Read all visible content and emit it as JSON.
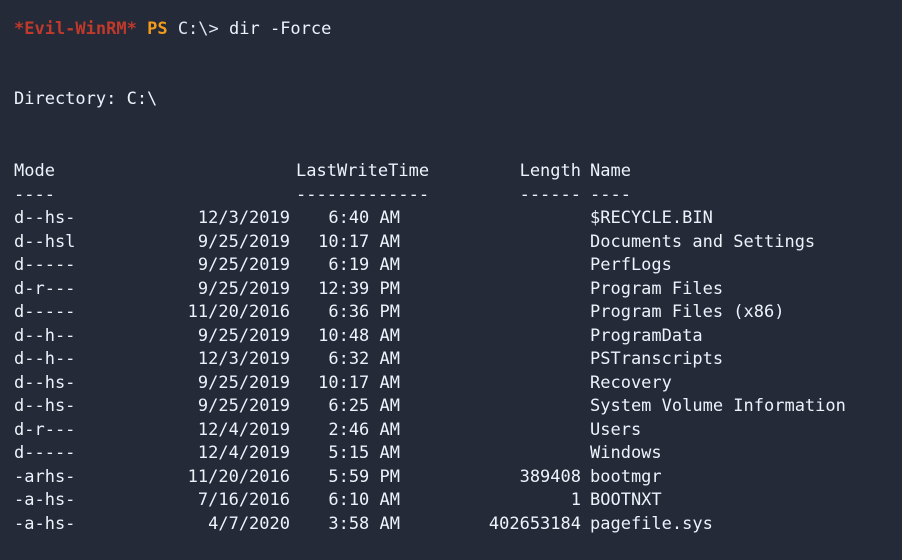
{
  "terminal": {
    "background": "#242a38",
    "foreground": "#eef2fb",
    "prompt": {
      "shell_marker": "*Evil-WinRM*",
      "shell_marker_color": "#c0392b",
      "ps_label": "PS",
      "ps_color": "#f29b1d",
      "path": "C:\\>",
      "command": "dir -Force"
    },
    "directory_header": "Directory: C:\\",
    "columns": {
      "mode": "Mode",
      "lastwritetime": "LastWriteTime",
      "length": "Length",
      "name": "Name"
    },
    "column_rules": {
      "mode": "----",
      "lastwritetime": "-------------",
      "length": "------",
      "name": "----"
    },
    "entries": [
      {
        "mode": "d--hs-",
        "date": "12/3/2019",
        "time": "6:40 AM",
        "length": "",
        "name": "$RECYCLE.BIN"
      },
      {
        "mode": "d--hsl",
        "date": "9/25/2019",
        "time": "10:17 AM",
        "length": "",
        "name": "Documents and Settings"
      },
      {
        "mode": "d-----",
        "date": "9/25/2019",
        "time": "6:19 AM",
        "length": "",
        "name": "PerfLogs"
      },
      {
        "mode": "d-r---",
        "date": "9/25/2019",
        "time": "12:39 PM",
        "length": "",
        "name": "Program Files"
      },
      {
        "mode": "d-----",
        "date": "11/20/2016",
        "time": "6:36 PM",
        "length": "",
        "name": "Program Files (x86)"
      },
      {
        "mode": "d--h--",
        "date": "9/25/2019",
        "time": "10:48 AM",
        "length": "",
        "name": "ProgramData"
      },
      {
        "mode": "d--h--",
        "date": "12/3/2019",
        "time": "6:32 AM",
        "length": "",
        "name": "PSTranscripts"
      },
      {
        "mode": "d--hs-",
        "date": "9/25/2019",
        "time": "10:17 AM",
        "length": "",
        "name": "Recovery"
      },
      {
        "mode": "d--hs-",
        "date": "9/25/2019",
        "time": "6:25 AM",
        "length": "",
        "name": "System Volume Information"
      },
      {
        "mode": "d-r---",
        "date": "12/4/2019",
        "time": "2:46 AM",
        "length": "",
        "name": "Users"
      },
      {
        "mode": "d-----",
        "date": "12/4/2019",
        "time": "5:15 AM",
        "length": "",
        "name": "Windows"
      },
      {
        "mode": "-arhs-",
        "date": "11/20/2016",
        "time": "5:59 PM",
        "length": "389408",
        "name": "bootmgr"
      },
      {
        "mode": "-a-hs-",
        "date": "7/16/2016",
        "time": "6:10 AM",
        "length": "1",
        "name": "BOOTNXT"
      },
      {
        "mode": "-a-hs-",
        "date": "4/7/2020",
        "time": "3:58 AM",
        "length": "402653184",
        "name": "pagefile.sys"
      }
    ]
  }
}
